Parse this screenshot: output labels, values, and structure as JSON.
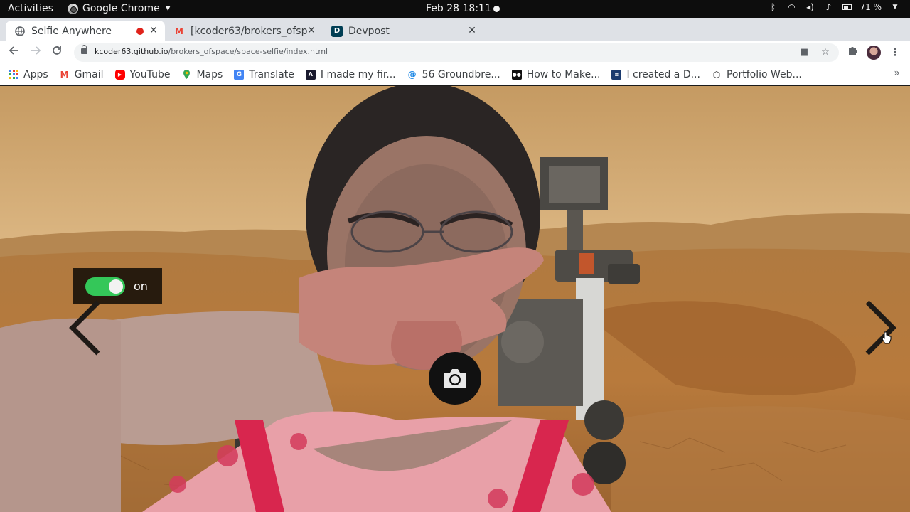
{
  "system_bar": {
    "activities": "Activities",
    "app_name": "Google Chrome",
    "clock": "Feb 28  18:11",
    "battery": "71 %"
  },
  "tabs": [
    {
      "title": "Selfie Anywhere",
      "active": true,
      "favicon": "globe-icon",
      "recording": true
    },
    {
      "title": "[kcoder63/brokers_ofsp",
      "active": false,
      "favicon": "gmail-icon"
    },
    {
      "title": "Devpost",
      "active": false,
      "favicon": "devpost-icon"
    }
  ],
  "address_bar": {
    "domain": "kcoder63.github.io",
    "path": "/brokers_ofspace/space-selfie/index.html"
  },
  "bookmarks": [
    {
      "label": "Apps",
      "icon": "apps-grid-icon",
      "color": "#4285f4"
    },
    {
      "label": "Gmail",
      "icon": "gmail-icon",
      "color": "#ea4335"
    },
    {
      "label": "YouTube",
      "icon": "youtube-icon",
      "color": "#ff0000"
    },
    {
      "label": "Maps",
      "icon": "maps-icon",
      "color": "#34a853"
    },
    {
      "label": "Translate",
      "icon": "translate-icon",
      "color": "#4285f4"
    },
    {
      "label": "I made my fir...",
      "icon": "dev-icon",
      "color": "#1a1a2e"
    },
    {
      "label": "56 Groundbre...",
      "icon": "swirl-icon",
      "color": "#1e88e5"
    },
    {
      "label": "How to Make...",
      "icon": "video-icon",
      "color": "#111111"
    },
    {
      "label": "I created a D...",
      "icon": "article-icon",
      "color": "#1a3a6e"
    },
    {
      "label": "Portfolio Web...",
      "icon": "codepen-icon",
      "color": "#222222"
    }
  ],
  "page": {
    "toggle_label": "on",
    "toggle_on": true,
    "accent_color": "#34c759"
  }
}
